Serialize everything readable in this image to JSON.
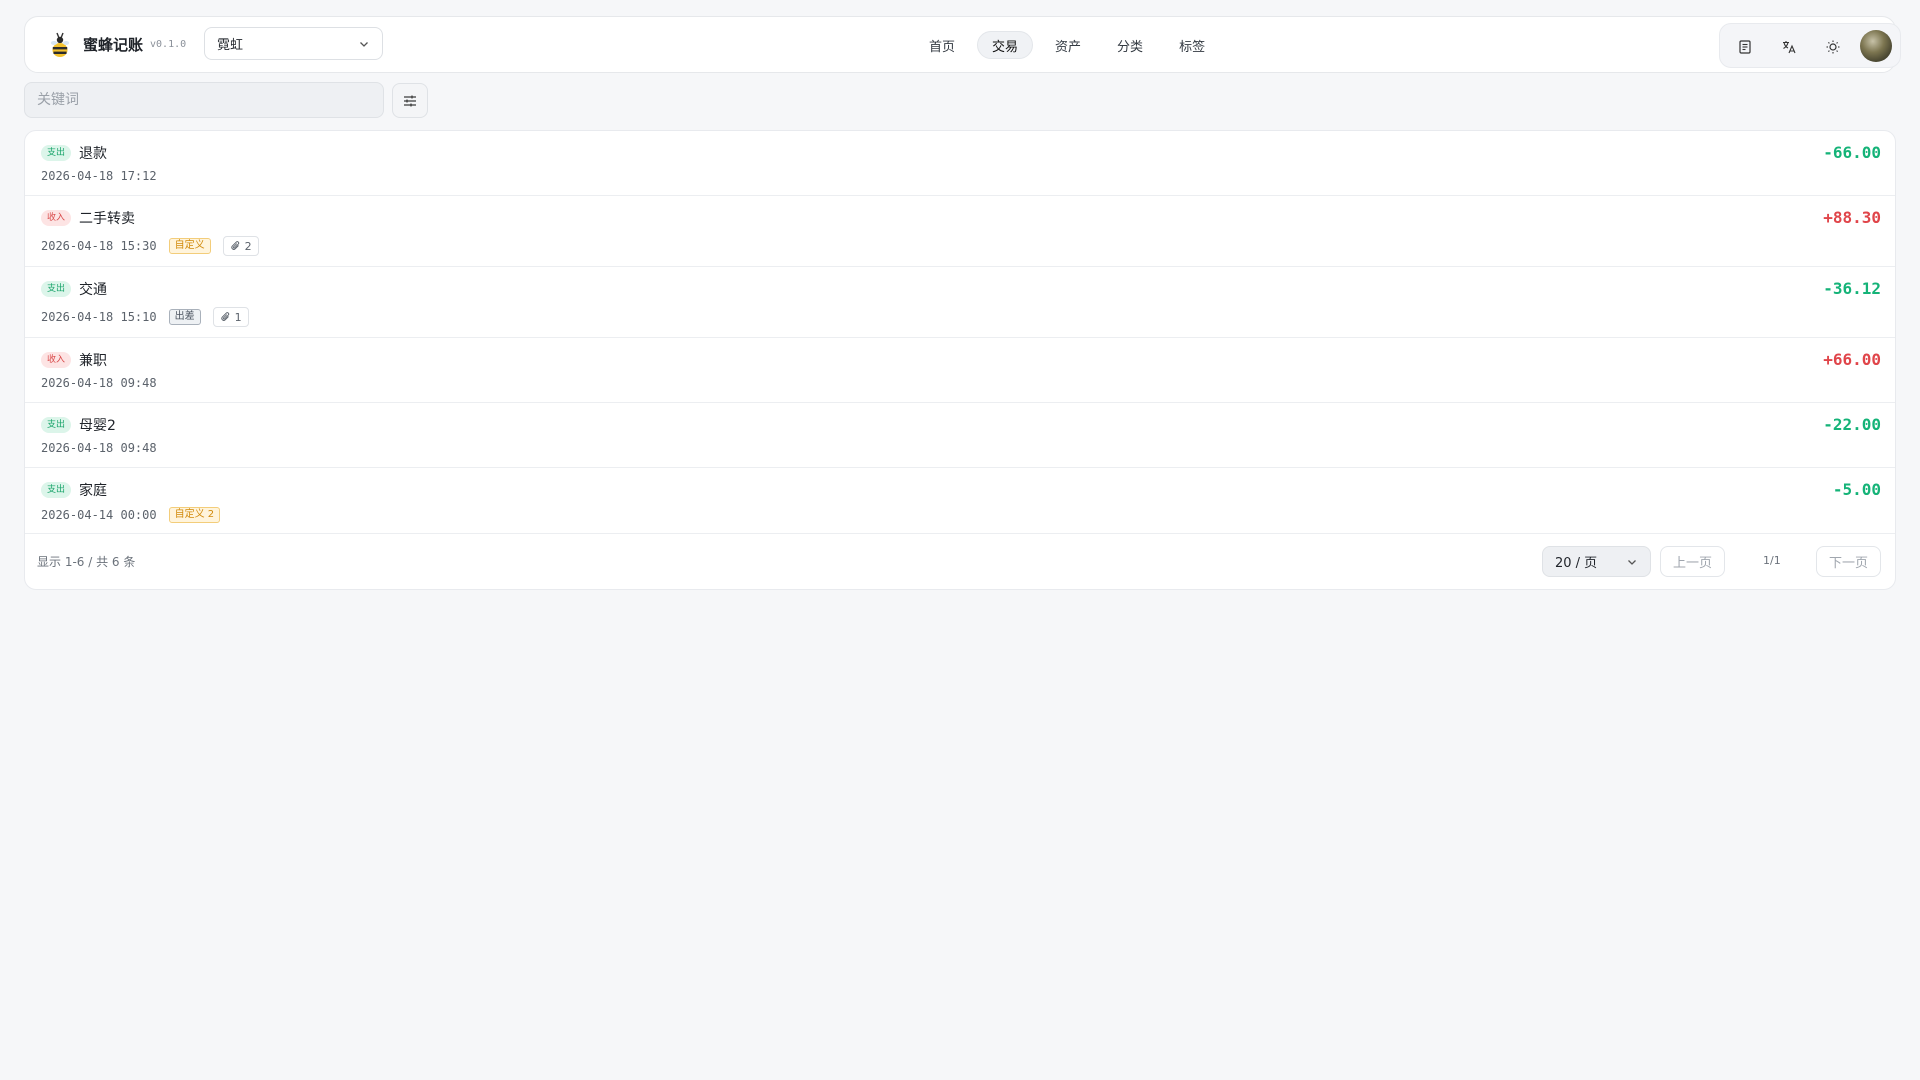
{
  "app": {
    "name": "蜜蜂记账",
    "version": "v0.1.0"
  },
  "book_select": {
    "value": "霓虹"
  },
  "nav": {
    "items": [
      {
        "label": "首页",
        "active": false
      },
      {
        "label": "交易",
        "active": true
      },
      {
        "label": "资产",
        "active": false
      },
      {
        "label": "分类",
        "active": false
      },
      {
        "label": "标签",
        "active": false
      }
    ]
  },
  "tools": {
    "icons": [
      "ledger-icon",
      "translate-icon",
      "sun-icon"
    ],
    "avatar": "user-avatar"
  },
  "search": {
    "placeholder": "关键词",
    "value": ""
  },
  "transactions": [
    {
      "type": "expense",
      "type_label": "支出",
      "title": "退款",
      "date": "2026-04-18 17:12",
      "amount": "-66.00",
      "tags": [],
      "attachments": null
    },
    {
      "type": "income",
      "type_label": "收入",
      "title": "二手转卖",
      "date": "2026-04-18 15:30",
      "amount": "+88.30",
      "tags": [
        {
          "label": "自定义",
          "color": "orange"
        }
      ],
      "attachments": "2"
    },
    {
      "type": "expense",
      "type_label": "支出",
      "title": "交通",
      "date": "2026-04-18 15:10",
      "amount": "-36.12",
      "tags": [
        {
          "label": "出差",
          "color": "gray"
        }
      ],
      "attachments": "1"
    },
    {
      "type": "income",
      "type_label": "收入",
      "title": "兼职",
      "date": "2026-04-18 09:48",
      "amount": "+66.00",
      "tags": [],
      "attachments": null
    },
    {
      "type": "expense",
      "type_label": "支出",
      "title": "母婴2",
      "date": "2026-04-18 09:48",
      "amount": "-22.00",
      "tags": [],
      "attachments": null
    },
    {
      "type": "expense",
      "type_label": "支出",
      "title": "家庭",
      "date": "2026-04-14 00:00",
      "amount": "-5.00",
      "tags": [
        {
          "label": "自定义 2",
          "color": "orange"
        }
      ],
      "attachments": null
    }
  ],
  "footer": {
    "summary": "显示 1-6 / 共 6 条",
    "per_page": "20 / 页",
    "prev": "上一页",
    "page": "1/1",
    "next": "下一页"
  },
  "colors": {
    "expense": "#15b378",
    "income": "#e0454a",
    "tag_orange": "#d18a0c"
  }
}
